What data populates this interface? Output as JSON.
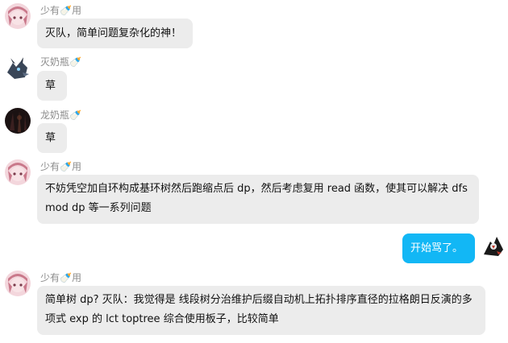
{
  "messages": [
    {
      "sender": "少有🍼用",
      "text": "灭队，简单问题复杂化的神！"
    },
    {
      "sender": "灭奶瓶🍼",
      "text": "草"
    },
    {
      "sender": "龙奶瓶🍼",
      "text": "草"
    },
    {
      "sender": "少有🍼用",
      "text": "不妨凭空加自环构成基环树然后跑缩点后 dp，然后考虑复用 read 函数，使其可以解决 dfs mod dp 等一系列问题"
    },
    {
      "sender": "",
      "text": "开始骂了。"
    },
    {
      "sender": "少有🍼用",
      "text": "简单树 dp? 灭队：我觉得是 线段树分治维护后缀自动机上拓扑排序直径的拉格朗日反演的多项式 exp 的 lct toptree 综合使用板子，比较简单"
    }
  ],
  "colors": {
    "bubble_other": "#ececec",
    "bubble_self": "#12b7f5",
    "name_text": "#8c8c8c"
  },
  "icons": [
    "anime-girl-avatar",
    "dragon-avatar",
    "dark-avatar",
    "self-avatar"
  ]
}
